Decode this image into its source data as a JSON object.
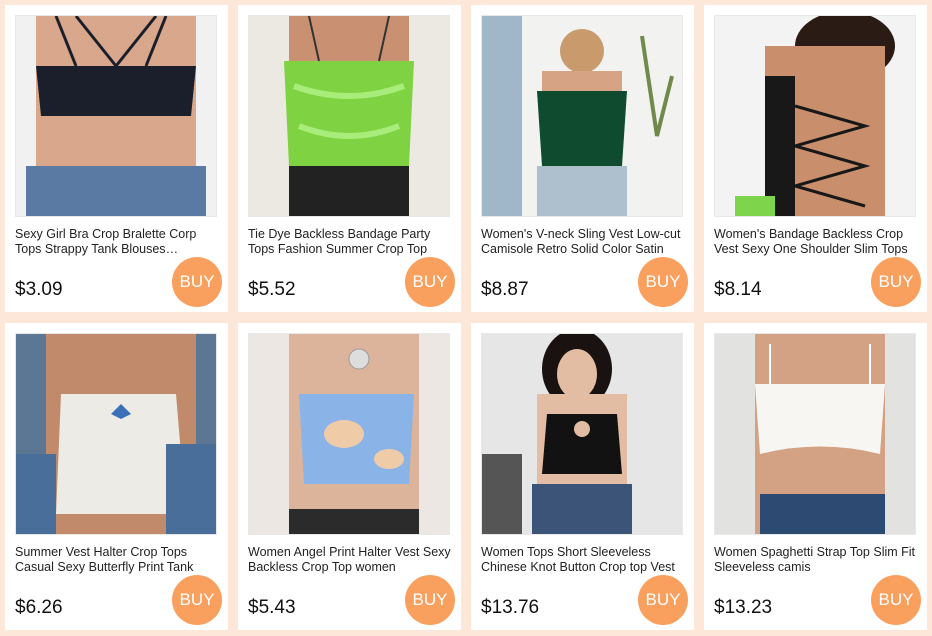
{
  "products": [
    {
      "title": "Sexy Girl Bra Crop Bralette Corp Tops Strappy Tank Blouses Camisole",
      "price": "$3.09",
      "buy_label": "BUY",
      "top_color": "#1b1f2b",
      "bg_color": "#f1f1f1",
      "skin": "#d9a88c"
    },
    {
      "title": "Tie Dye Backless Bandage Party Tops Fashion Summer Crop Top",
      "price": "$5.52",
      "buy_label": "BUY",
      "top_color": "#7fd343",
      "bg_color": "#ece8e2",
      "skin": "#c99072"
    },
    {
      "title": "Women's V-neck Sling Vest Low-cut Camisole Retro Solid Color Satin",
      "price": "$8.87",
      "buy_label": "BUY",
      "top_color": "#0f4b2e",
      "bg_color": "#f2f2f0",
      "skin": "#d6a484"
    },
    {
      "title": "Women's Bandage Backless Crop Vest Sexy One Shoulder Slim Tops",
      "price": "$8.14",
      "buy_label": "BUY",
      "top_color": "#181818",
      "bg_color": "#f3f3f3",
      "skin": "#c98f6d"
    },
    {
      "title": "Summer Vest Halter Crop Tops Casual Sexy Butterfly Print Tank",
      "price": "$6.26",
      "buy_label": "BUY",
      "top_color": "#ecebe5",
      "bg_color": "#5b7794",
      "skin": "#c18a6a"
    },
    {
      "title": "Women Angel Print Halter Vest Sexy Backless Crop Top women",
      "price": "$5.43",
      "buy_label": "BUY",
      "top_color": "#8ab4e8",
      "bg_color": "#ece7e3",
      "skin": "#dcb39b"
    },
    {
      "title": "Women Tops Short Sleeveless Chinese Knot Button Crop top Vest",
      "price": "$13.76",
      "buy_label": "BUY",
      "top_color": "#121212",
      "bg_color": "#e6e6e6",
      "skin": "#e3bca4"
    },
    {
      "title": "Women Spaghetti Strap Top Slim Fit Sleeveless camis",
      "price": "$13.23",
      "buy_label": "BUY",
      "top_color": "#f7f6f2",
      "bg_color": "#e2e2e0",
      "skin": "#d3a183"
    }
  ]
}
